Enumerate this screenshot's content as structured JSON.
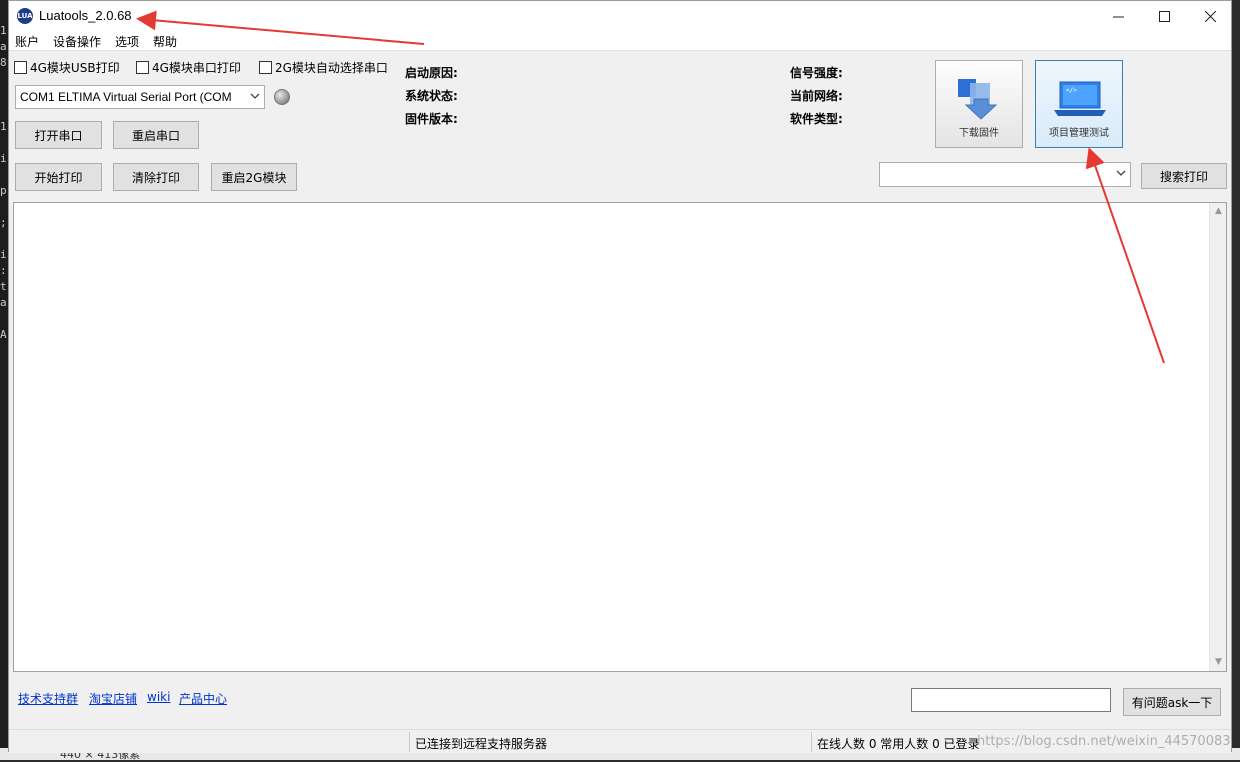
{
  "background": {
    "left_console_chars": [
      "1",
      "a",
      "8",
      "1",
      "i",
      "p",
      ";",
      "i",
      ":",
      "t",
      "a",
      "A"
    ],
    "taskbar_text": "440 × 413像素"
  },
  "window": {
    "title": "Luatools_2.0.68",
    "icon": "luatools-app-icon",
    "controls": [
      "minimize-icon",
      "maximize-icon",
      "close-icon"
    ]
  },
  "menu": [
    "账户",
    "设备操作",
    "选项",
    "帮助"
  ],
  "print_options": {
    "usb_4g": "4G模块USB打印",
    "serial_4g": "4G模块串口打印",
    "auto_2g": "2G模块自动选择串口"
  },
  "port_select": {
    "value": "COM1 ELTIMA Virtual Serial Port (COM"
  },
  "buttons": {
    "open_port": "打开串口",
    "restart_port": "重启串口",
    "start_print": "开始打印",
    "clear_print": "清除打印",
    "restart_2g": "重启2G模块",
    "search_print": "搜索打印",
    "ask": "有问题ask一下"
  },
  "device_info": {
    "boot_reason": "启动原因:",
    "system_status": "系统状态:",
    "firmware_version": "固件版本:",
    "signal_strength": "信号强度:",
    "current_network": "当前网络:",
    "software_type": "软件类型:"
  },
  "tools": {
    "download_firmware": "下载固件",
    "project_test": "项目管理测试"
  },
  "search_select": {
    "value": ""
  },
  "links": [
    "技术支持群",
    "淘宝店铺",
    "wiki",
    "产品中心"
  ],
  "ask_input": {
    "value": ""
  },
  "status": {
    "remote": "已连接到远程支持服务器",
    "online": "在线人数 0 常用人数 0 已登录"
  },
  "watermark": "https://blog.csdn.net/weixin_44570083",
  "colors": {
    "annotation_arrow": "#e53935",
    "link": "#0033cc",
    "active_tool_border": "#3c7fb1"
  }
}
